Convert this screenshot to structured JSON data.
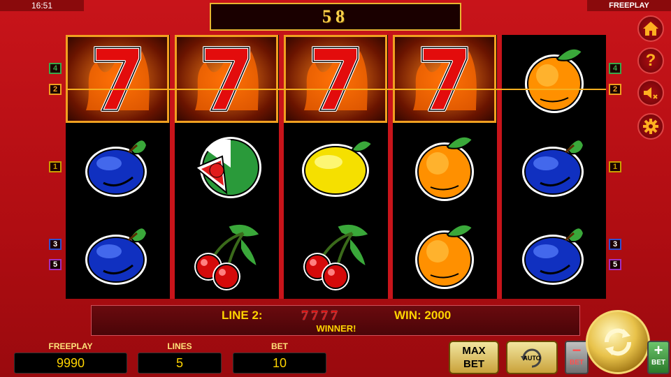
{
  "status": {
    "time": "16:51",
    "mode": "FREEPLAY"
  },
  "top_display": {
    "value": "58"
  },
  "reels": [
    [
      "seven",
      "plum",
      "plum"
    ],
    [
      "seven",
      "watermelon",
      "cherries"
    ],
    [
      "seven",
      "lemon",
      "cherries"
    ],
    [
      "seven",
      "orange",
      "orange"
    ],
    [
      "orange",
      "plum",
      "plum"
    ]
  ],
  "winning_cells": [
    [
      0,
      0
    ],
    [
      1,
      0
    ],
    [
      2,
      0
    ],
    [
      3,
      0
    ]
  ],
  "line_markers_left": [
    {
      "label": "4",
      "color": "#3aa84a"
    },
    {
      "label": "2",
      "color": "#f0a020"
    },
    {
      "label": "1",
      "color": "#c8a000"
    },
    {
      "label": "3",
      "color": "#3050d0"
    },
    {
      "label": "5",
      "color": "#a030c0"
    }
  ],
  "line_markers_right": [
    {
      "label": "4",
      "color": "#3aa84a"
    },
    {
      "label": "2",
      "color": "#f0a020"
    },
    {
      "label": "1",
      "color": "#c8a000"
    },
    {
      "label": "3",
      "color": "#3050d0"
    },
    {
      "label": "5",
      "color": "#a030c0"
    }
  ],
  "info": {
    "line_label": "LINE 2:",
    "symbols": "7777",
    "win_label": "WIN: 2000",
    "winner_text": "WINNER!"
  },
  "stats": {
    "freeplay_label": "FREEPLAY",
    "freeplay_value": "9990",
    "lines_label": "LINES",
    "lines_value": "5",
    "bet_label": "BET",
    "bet_value": "10"
  },
  "buttons": {
    "max_bet_top": "MAX",
    "max_bet_bottom": "BET",
    "auto_label": "AUTO",
    "bet_minus_label": "BET",
    "bet_plus_label": "BET"
  },
  "side_icons": [
    "home-icon",
    "help-icon",
    "sound-muted-icon",
    "settings-icon"
  ],
  "colors": {
    "background": "#c8141a",
    "gold": "#ffd400",
    "payline": "#f5b020"
  }
}
